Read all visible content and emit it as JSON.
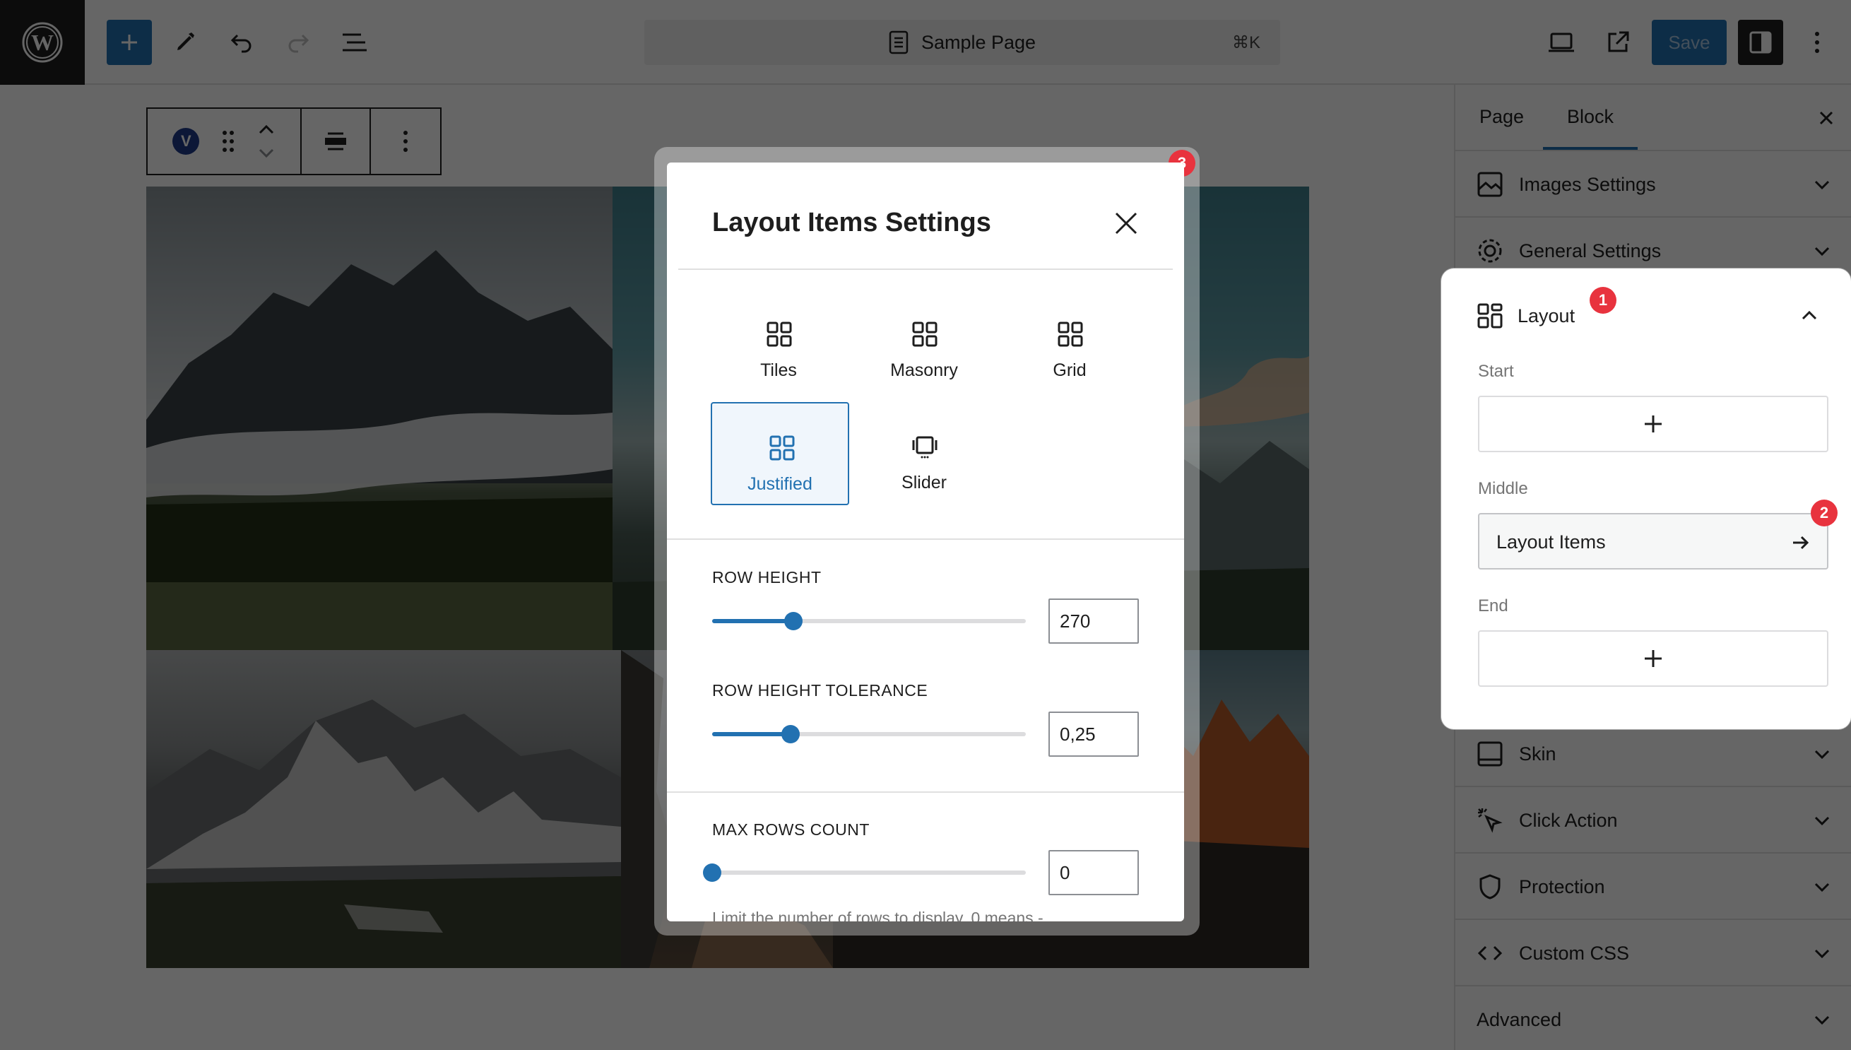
{
  "header": {
    "document_title": "Sample Page",
    "shortcut": "⌘K",
    "save_label": "Save"
  },
  "block_toolbar": {
    "block_badge": "V"
  },
  "sidebar": {
    "tabs": [
      {
        "label": "Page",
        "active": false
      },
      {
        "label": "Block",
        "active": true
      }
    ],
    "panels": [
      {
        "title": "Images Settings",
        "icon": "image-icon",
        "expanded": false
      },
      {
        "title": "General Settings",
        "icon": "gear-icon",
        "expanded": false
      },
      {
        "title": "Layout",
        "icon": "layout-grid-icon",
        "expanded": true
      },
      {
        "title": "Skin",
        "icon": "skin-icon",
        "expanded": false
      },
      {
        "title": "Click Action",
        "icon": "cursor-click-icon",
        "expanded": false
      },
      {
        "title": "Protection",
        "icon": "shield-icon",
        "expanded": false
      },
      {
        "title": "Custom CSS",
        "icon": "code-icon",
        "expanded": false
      },
      {
        "title": "Advanced",
        "icon": "",
        "expanded": false
      }
    ],
    "layout": {
      "start_label": "Start",
      "middle_label": "Middle",
      "end_label": "End",
      "layout_items_label": "Layout Items"
    }
  },
  "badges": [
    "1",
    "2",
    "3"
  ],
  "modal": {
    "title": "Layout Items Settings",
    "options": [
      {
        "label": "Tiles",
        "selected": false
      },
      {
        "label": "Masonry",
        "selected": false
      },
      {
        "label": "Grid",
        "selected": false
      },
      {
        "label": "Justified",
        "selected": true
      },
      {
        "label": "Slider",
        "selected": false
      }
    ],
    "row_height": {
      "label": "ROW HEIGHT",
      "value": "270",
      "slider_fraction": 0.26
    },
    "row_height_tolerance": {
      "label": "ROW HEIGHT TOLERANCE",
      "value": "0,25",
      "slider_fraction": 0.25
    },
    "max_rows_count": {
      "label": "MAX ROWS COUNT",
      "value": "0",
      "slider_fraction": 0.0
    },
    "help_text": "Limit the number of rows to display. 0 means -"
  },
  "colors": {
    "accent": "#2271b1",
    "badge": "#e8333e",
    "overlay": "rgba(0,0,0,0.6)"
  }
}
